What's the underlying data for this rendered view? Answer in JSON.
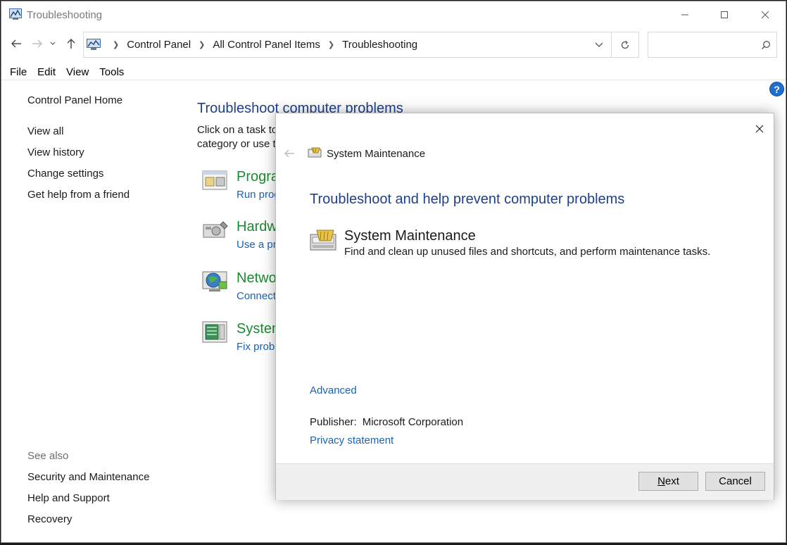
{
  "window": {
    "title": "Troubleshooting",
    "icon": "control-panel-icon"
  },
  "address_bar": {
    "crumbs": [
      "Control Panel",
      "All Control Panel Items",
      "Troubleshooting"
    ],
    "search_placeholder": ""
  },
  "menu": {
    "file": "File",
    "edit": "Edit",
    "view": "View",
    "tools": "Tools"
  },
  "sidebar": {
    "home": "Control Panel Home",
    "links": [
      "View all",
      "View history",
      "Change settings",
      "Get help from a friend"
    ],
    "see_also_label": "See also",
    "see_also": [
      "Security and Maintenance",
      "Help and Support",
      "Recovery"
    ]
  },
  "main": {
    "title": "Troubleshoot computer problems",
    "desc_line1": "Click on a task to",
    "desc_line2": "category or use t",
    "categories": [
      {
        "title": "Progra",
        "sub": "Run prog",
        "icon": "programs-icon"
      },
      {
        "title": "Hardw",
        "sub": "Use a pr",
        "icon": "hardware-icon"
      },
      {
        "title": "Netwo",
        "sub": "Connect",
        "icon": "network-icon"
      },
      {
        "title": "System",
        "sub": "Fix prob",
        "icon": "system-icon"
      }
    ]
  },
  "dialog": {
    "header_title": "System Maintenance",
    "heading": "Troubleshoot and help prevent computer problems",
    "item_title": "System Maintenance",
    "item_desc": "Find and clean up unused files and shortcuts, and perform maintenance tasks.",
    "advanced": "Advanced",
    "publisher_label": "Publisher:",
    "publisher_value": "Microsoft Corporation",
    "privacy": "Privacy statement",
    "next_mnemonic": "N",
    "next_rest": "ext",
    "cancel": "Cancel"
  },
  "colors": {
    "link_blue": "#1a62b8",
    "heading_blue": "#1e3f8c",
    "category_green": "#1b8a2f"
  }
}
